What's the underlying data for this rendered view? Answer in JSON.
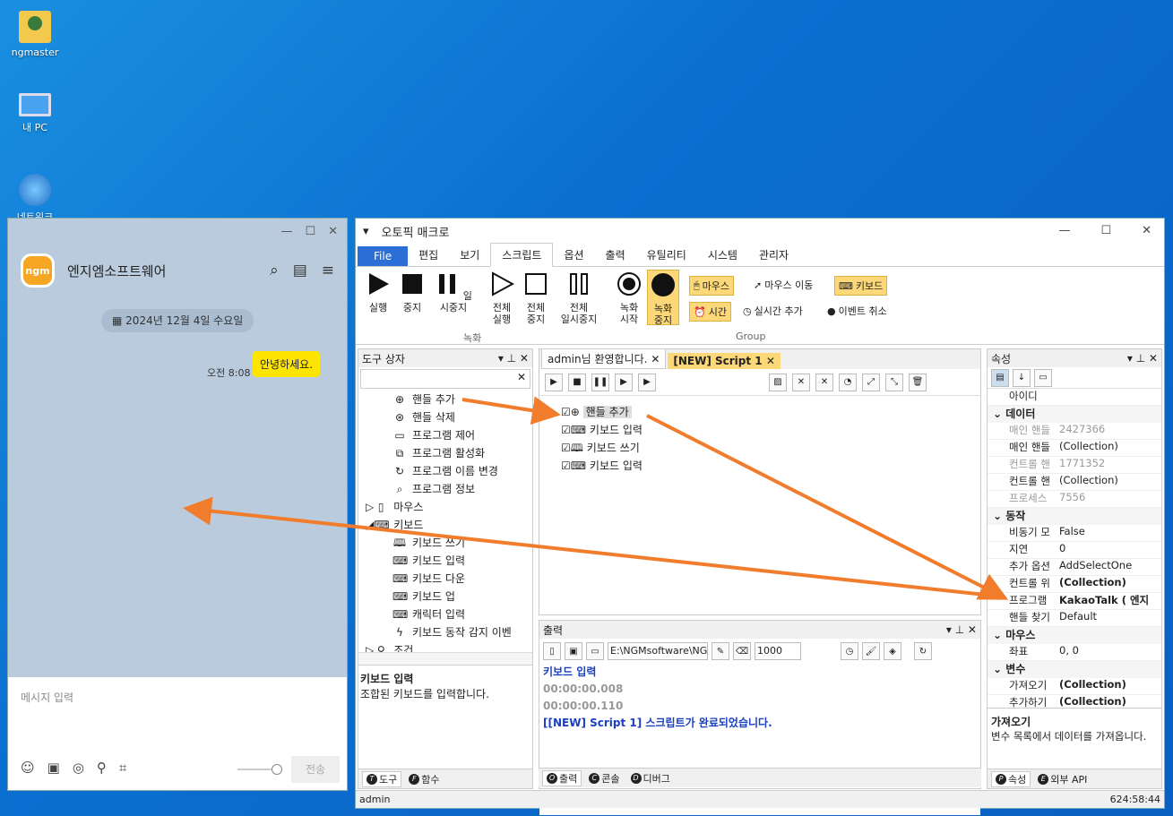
{
  "desktop": {
    "icons": [
      {
        "label": "ngmaster"
      },
      {
        "label": "내 PC"
      },
      {
        "label": "네트워크"
      }
    ]
  },
  "kakao": {
    "chat_name": "엔지엠소프트웨어",
    "avatar_text": "ngm",
    "date": "2024년 12월 4일 수요일",
    "message": {
      "time": "오전 8:08",
      "text": "안녕하세요."
    },
    "input_placeholder": "메시지 입력",
    "send_label": "전송"
  },
  "macro": {
    "title": "오토픽 매크로",
    "menu": [
      "File",
      "편집",
      "보기",
      "스크립트",
      "옵션",
      "출력",
      "유틸리티",
      "시스템",
      "관리자"
    ],
    "ribbon": {
      "run": "실행",
      "stop": "중지",
      "pause": "일시중지",
      "all_run": "전체\n실행",
      "all_stop": "전체\n중지",
      "all_pause": "전체\n일시중지",
      "group1": "녹화",
      "rec_start": "녹화\n시작",
      "rec_stop": "녹화\n중지",
      "mouse": "마우스",
      "mouse_move": "마우스 이동",
      "keyboard": "키보드",
      "time": "시간",
      "realtime_add": "실시간 추가",
      "event_cancel": "이벤트 취소",
      "group2": "Group"
    },
    "toolbox": {
      "title": "도구 상자",
      "items": [
        {
          "label": "핸들 추가",
          "icon": "crosshair-icon"
        },
        {
          "label": "핸들 삭제",
          "icon": "crosshair-delete-icon"
        },
        {
          "label": "프로그램 제어",
          "icon": "laptop-icon"
        },
        {
          "label": "프로그램 활성화",
          "icon": "window-icon"
        },
        {
          "label": "프로그램 이름 변경",
          "icon": "rename-icon"
        },
        {
          "label": "프로그램 정보",
          "icon": "magnifier-icon"
        },
        {
          "label": "마우스",
          "icon": "mouse-icon"
        },
        {
          "label": "키보드",
          "icon": "keyboard-icon"
        },
        {
          "label": "키보드 쓰기",
          "icon": "book-icon"
        },
        {
          "label": "키보드 입력",
          "icon": "keyboard-icon"
        },
        {
          "label": "키보드 다운",
          "icon": "keyboard-down-icon"
        },
        {
          "label": "키보드 업",
          "icon": "keyboard-up-icon"
        },
        {
          "label": "캐릭터 입력",
          "icon": "keyboard-icon"
        },
        {
          "label": "키보드 동작 감지 이벤",
          "icon": "bolt-icon"
        },
        {
          "label": "조건",
          "icon": "pin-icon"
        }
      ],
      "desc_title": "키보드 입력",
      "desc_text": "조합된 키보드를 입력합니다.",
      "tabs": [
        "도구",
        "함수"
      ]
    },
    "doc_tabs": [
      "admin님 환영합니다.",
      "[NEW] Script 1"
    ],
    "script_items": [
      "핸들 추가",
      "키보드 입력",
      "키보드 쓰기",
      "키보드 입력"
    ],
    "output": {
      "title": "출력",
      "path": "E:\\NGMsoftware\\NG",
      "number": "1000",
      "lines": [
        "키보드 입력",
        "00:00:00.008",
        "00:00:00.110",
        "[[NEW] Script 1] 스크립트가 완료되었습니다."
      ],
      "tabs": [
        "출력",
        "콘솔",
        "디버그"
      ]
    },
    "properties": {
      "title": "속성",
      "rows": [
        {
          "k": "아이디",
          "v": "",
          "type": "row"
        },
        {
          "k": "데이터",
          "type": "cat"
        },
        {
          "k": "매인 핸들",
          "v": "2427366",
          "type": "gray"
        },
        {
          "k": "매인 핸들",
          "v": "(Collection)",
          "type": "row"
        },
        {
          "k": "컨트롤 핸",
          "v": "1771352",
          "type": "gray"
        },
        {
          "k": "컨트롤 핸",
          "v": "(Collection)",
          "type": "row"
        },
        {
          "k": "프로세스",
          "v": "7556",
          "type": "gray"
        },
        {
          "k": "동작",
          "type": "cat"
        },
        {
          "k": "비동기 모",
          "v": "False",
          "type": "row"
        },
        {
          "k": "지연",
          "v": "0",
          "type": "row"
        },
        {
          "k": "추가 옵션",
          "v": "AddSelectOne",
          "type": "row"
        },
        {
          "k": "컨트롤 위",
          "v": "(Collection)",
          "type": "bold"
        },
        {
          "k": "프로그램",
          "v": "KakaoTalk ( 엔지",
          "type": "bold"
        },
        {
          "k": "핸들 찾기",
          "v": "Default",
          "type": "row"
        },
        {
          "k": "마우스",
          "type": "cat"
        },
        {
          "k": "좌표",
          "v": "0, 0",
          "type": "row"
        },
        {
          "k": "변수",
          "type": "cat"
        },
        {
          "k": "가져오기",
          "v": "(Collection)",
          "type": "bold"
        },
        {
          "k": "추가하기",
          "v": "(Collection)",
          "type": "bold"
        }
      ],
      "desc_title": "가져오기",
      "desc_text": "변수 목록에서 데이터를 가져옵니다.",
      "tabs": [
        "속성",
        "외부 API"
      ]
    },
    "status": {
      "user": "admin",
      "time": "624:58:44"
    }
  }
}
